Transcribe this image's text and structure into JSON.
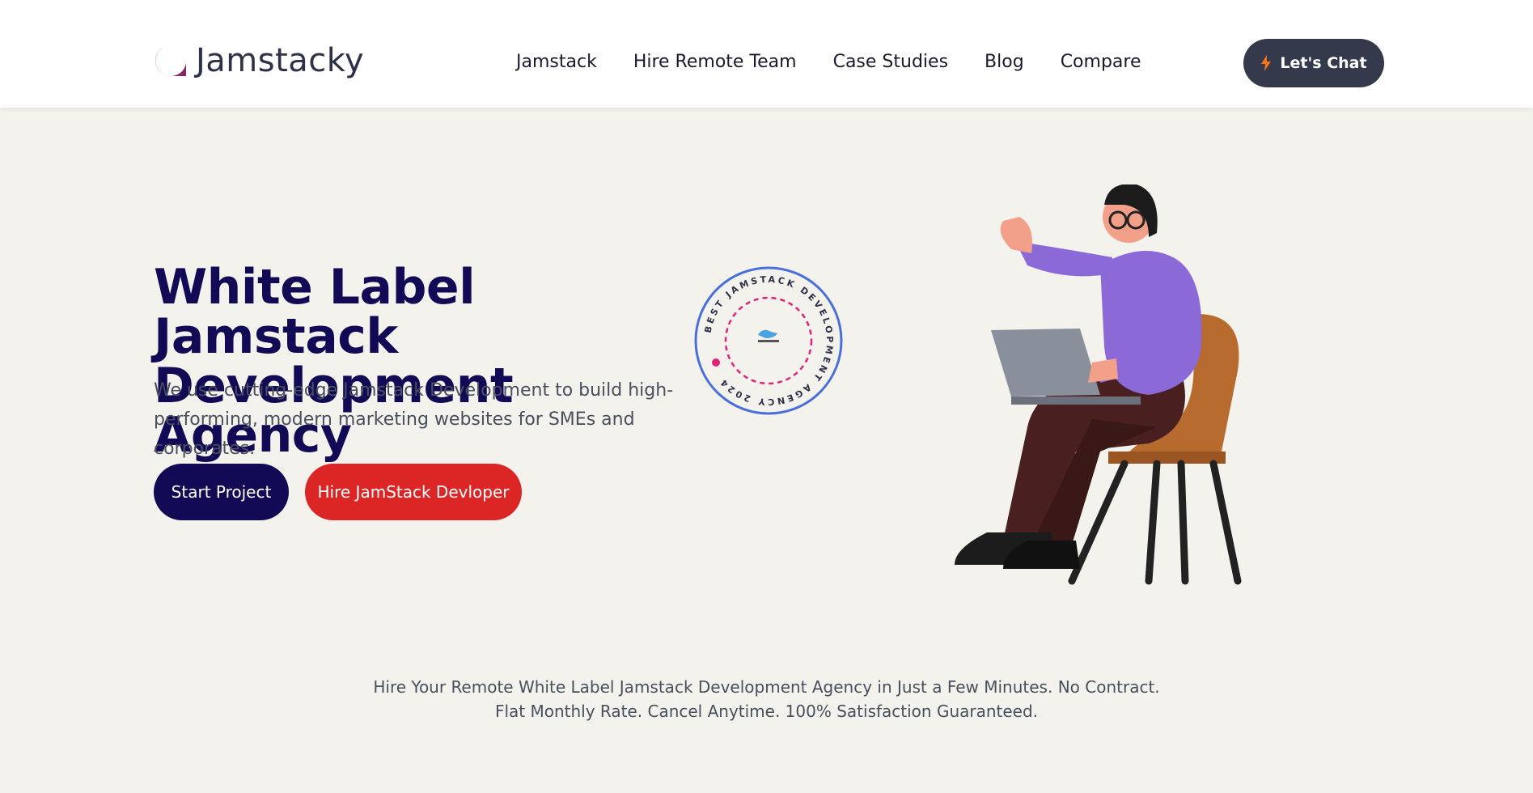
{
  "header": {
    "logo_text": "Jamstacky",
    "nav": [
      {
        "label": "Jamstack"
      },
      {
        "label": "Hire Remote Team"
      },
      {
        "label": "Case Studies"
      },
      {
        "label": "Blog"
      },
      {
        "label": "Compare"
      }
    ],
    "cta_label": "Let's Chat",
    "cta_icon": "lightning-icon"
  },
  "hero": {
    "title_line1": "White Label Jamstack",
    "title_line2": "Development Agency",
    "subtitle": "We use cutting-edge Jamstack Development to build high-performing, modern marketing websites for SMEs and corporates.",
    "primary_button": "Start Project",
    "secondary_button": "Hire JamStack Devloper",
    "badge_text": "BEST JAMSTACK DEVELOPMENT AGENCY 2024"
  },
  "tagline": "Hire Your Remote White Label Jamstack Development Agency in Just a Few Minutes. No Contract. Flat Monthly Rate. Cancel Anytime. 100% Satisfaction Guaranteed.",
  "colors": {
    "navy": "#130a55",
    "red": "#dc2626",
    "background": "#f3f2ec",
    "chat_button": "#343a4b"
  }
}
